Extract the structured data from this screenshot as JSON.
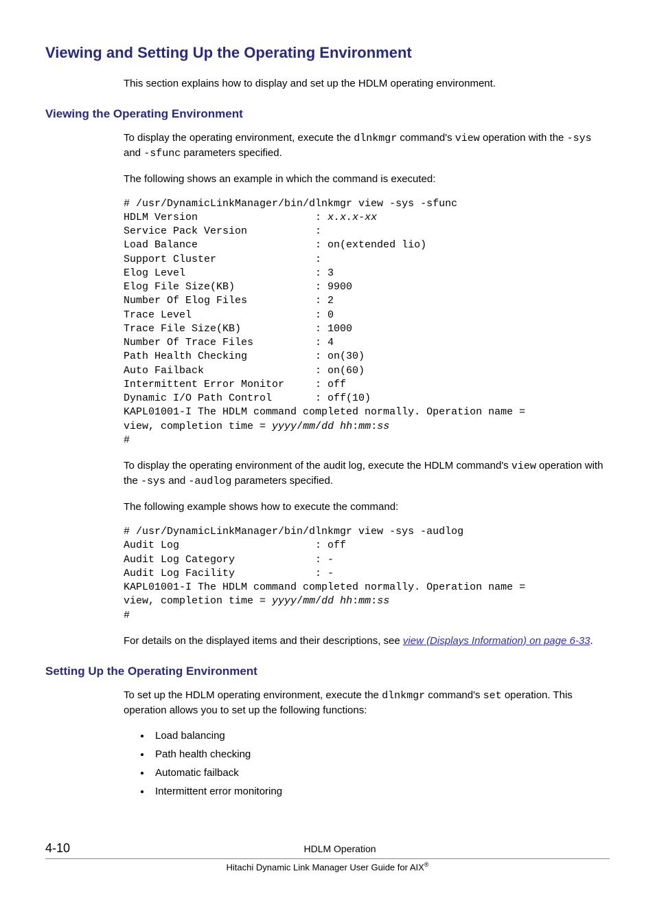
{
  "h1": "Viewing and Setting Up the Operating Environment",
  "intro": "This section explains how to display and set up the HDLM operating environment.",
  "sec1": {
    "title": "Viewing the Operating Environment",
    "p1a": "To display the operating environment, execute the ",
    "p1b": "dlnkmgr",
    "p1c": " command's ",
    "p1d": "view",
    "p1e": " operation with the ",
    "p1f": "-sys",
    "p1g": " and ",
    "p1h": "-sfunc",
    "p1i": " parameters specified.",
    "p2": "The following shows an example in which the command is executed:",
    "code1_l1": "# /usr/DynamicLinkManager/bin/dlnkmgr view -sys -sfunc",
    "code1_l2a": "HDLM Version                   : ",
    "code1_l2b": "x.x.x-xx",
    "code1_l3": "Service Pack Version           :",
    "code1_l4": "Load Balance                   : on(extended lio)",
    "code1_l5": "Support Cluster                :",
    "code1_l6": "Elog Level                     : 3",
    "code1_l7": "Elog File Size(KB)             : 9900",
    "code1_l8": "Number Of Elog Files           : 2",
    "code1_l9": "Trace Level                    : 0",
    "code1_l10": "Trace File Size(KB)            : 1000",
    "code1_l11": "Number Of Trace Files          : 4",
    "code1_l12": "Path Health Checking           : on(30)",
    "code1_l13": "Auto Failback                  : on(60)",
    "code1_l14": "Intermittent Error Monitor     : off",
    "code1_l15": "Dynamic I/O Path Control       : off(10)",
    "code1_l16": "KAPL01001-I The HDLM command completed normally. Operation name = ",
    "code1_l17a": "view, completion time = ",
    "code1_l17b": "yyyy",
    "code1_l17c": "/",
    "code1_l17d": "mm",
    "code1_l17e": "/",
    "code1_l17f": "dd",
    "code1_l17g": " ",
    "code1_l17h": "hh",
    "code1_l17i": ":",
    "code1_l17j": "mm",
    "code1_l17k": ":",
    "code1_l17l": "ss",
    "code1_l18": "#",
    "p3a": "To display the operating environment of the audit log, execute the HDLM command's ",
    "p3b": "view",
    "p3c": " operation with the ",
    "p3d": "-sys",
    "p3e": " and ",
    "p3f": "-audlog",
    "p3g": " parameters specified.",
    "p4": "The following example shows how to execute the command:",
    "code2_l1": "# /usr/DynamicLinkManager/bin/dlnkmgr view -sys -audlog",
    "code2_l2": "Audit Log                      : off",
    "code2_l3": "Audit Log Category             : -",
    "code2_l4": "Audit Log Facility             : -",
    "code2_l5": "KAPL01001-I The HDLM command completed normally. Operation name = ",
    "code2_l6a": "view, completion time = ",
    "code2_l6b": "yyyy",
    "code2_l6c": "/",
    "code2_l6d": "mm",
    "code2_l6e": "/",
    "code2_l6f": "dd",
    "code2_l6g": " ",
    "code2_l6h": "hh",
    "code2_l6i": ":",
    "code2_l6j": "mm",
    "code2_l6k": ":",
    "code2_l6l": "ss",
    "code2_l7": "#",
    "p5a": "For details on the displayed items and their descriptions, see ",
    "p5link": "view (Displays Information) on page 6-33",
    "p5b": "."
  },
  "sec2": {
    "title": "Setting Up the Operating Environment",
    "p1a": "To set up the HDLM operating environment, execute the ",
    "p1b": "dlnkmgr",
    "p1c": " command's ",
    "p1d": "set",
    "p1e": " operation. This operation allows you to set up the following functions:",
    "items": {
      "0": "Load balancing",
      "1": "Path health checking",
      "2": "Automatic failback",
      "3": "Intermittent error monitoring"
    }
  },
  "footer": {
    "page": "4-10",
    "title": "HDLM Operation",
    "sub_a": "Hitachi Dynamic Link Manager User Guide for AIX",
    "sub_b": "®"
  }
}
